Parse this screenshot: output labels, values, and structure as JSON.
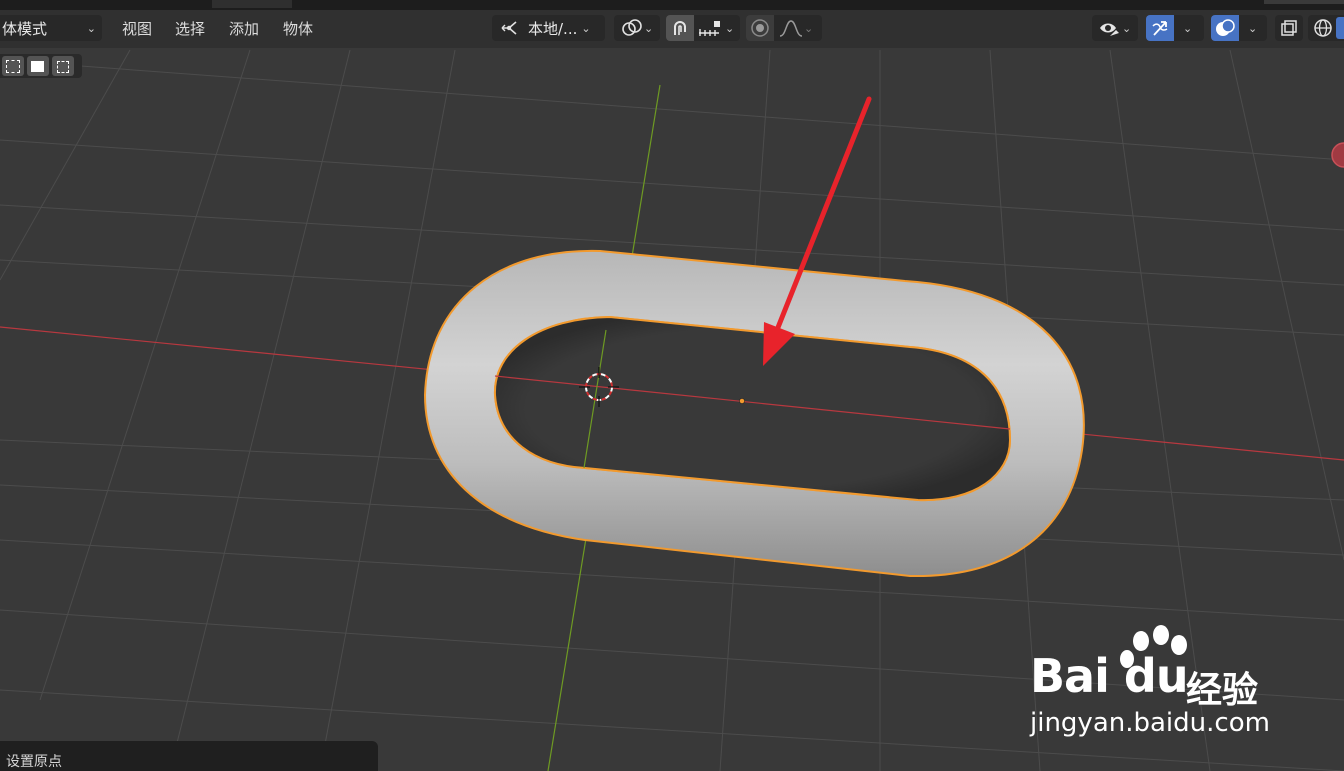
{
  "header": {
    "mode_label": "体模式",
    "menus": [
      "视图",
      "选择",
      "添加",
      "物体"
    ],
    "transform_orientation": "本地/..."
  },
  "status_bar": {
    "text": "设置原点"
  },
  "watermark": {
    "brand": "Bai  du",
    "product": "经验",
    "url": "jingyan.baidu.com"
  },
  "colors": {
    "background": "#393939",
    "header": "#303030",
    "selection_outline": "#f29a2e",
    "x_axis": "#b8383f",
    "y_axis": "#6e9a23",
    "annotation_arrow": "#e8232b",
    "active_button": "#4773c4"
  },
  "icons": [
    "orientation-icon",
    "pivot-icon",
    "snap-icon",
    "snap-increment-icon",
    "proportional-edit-icon",
    "falloff-icon",
    "visibility-icon",
    "gizmo-icon",
    "overlay-icon",
    "xray-icon",
    "wireframe-shading-icon",
    "selection-mode-icons"
  ]
}
